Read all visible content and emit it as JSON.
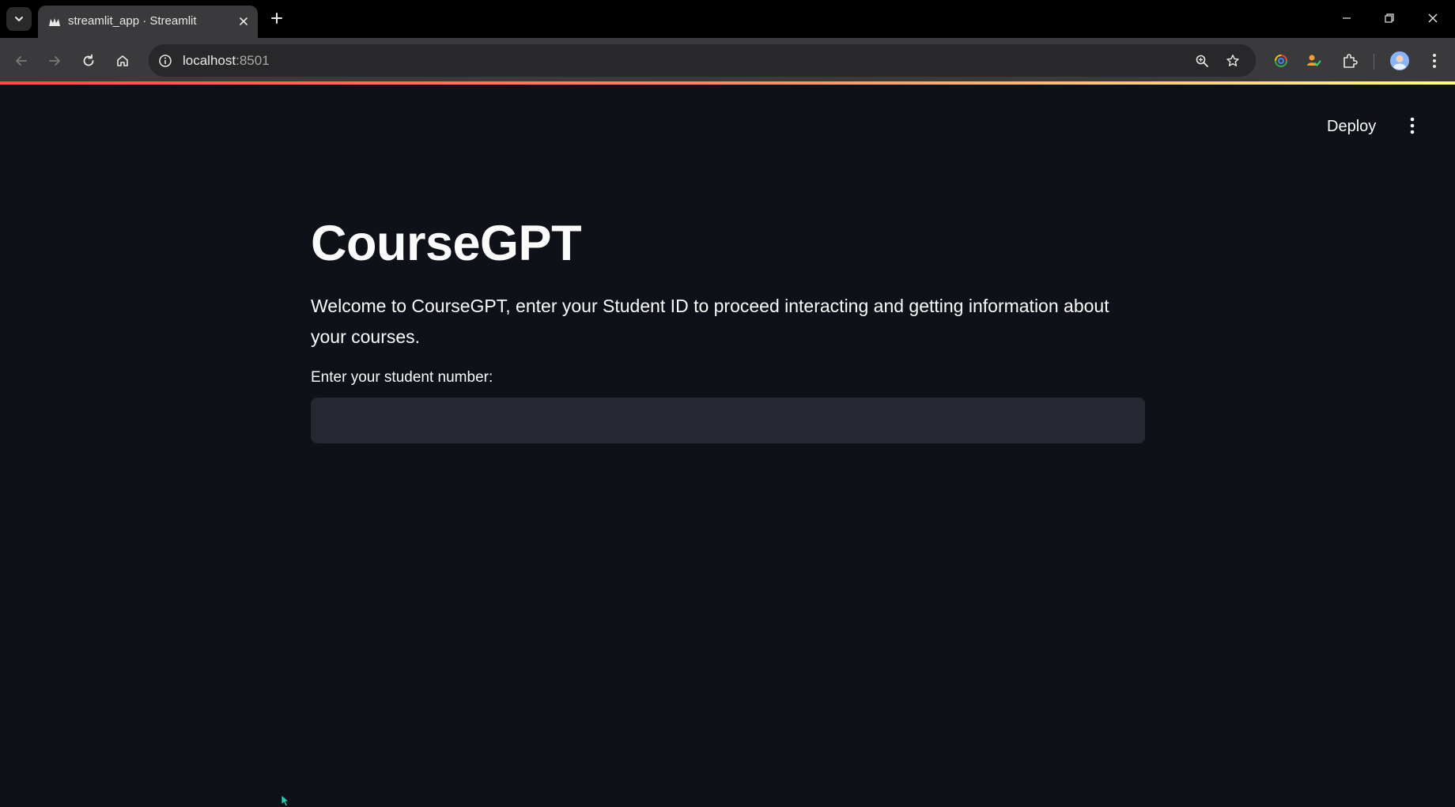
{
  "browser": {
    "tab_title": "streamlit_app · Streamlit",
    "url_host": "localhost",
    "url_port": ":8501",
    "icons": {
      "tab_list": "chevron-down-icon",
      "favicon": "streamlit-crown-icon",
      "close_tab": "close-icon",
      "new_tab": "plus-icon",
      "back": "arrow-left-icon",
      "forward": "arrow-right-icon",
      "reload": "reload-icon",
      "home": "home-icon",
      "site_info": "info-icon",
      "zoom": "zoom-icon",
      "bookmark": "star-icon",
      "extension_1": "colorful-extension-icon",
      "extension_2": "person-check-icon",
      "extensions": "puzzle-icon",
      "profile": "avatar",
      "menu": "kebab-menu-icon",
      "minimize": "minimize-icon",
      "restore": "restore-icon",
      "close_window": "close-icon"
    },
    "colors": {
      "tabbar": "#000000",
      "toolbar": "#3a3a3c",
      "loading_gradient": [
        "#ff4b4b",
        "#fffd80"
      ]
    }
  },
  "app": {
    "deploy_label": "Deploy",
    "title": "CourseGPT",
    "intro": "Welcome to CourseGPT, enter your Student ID to proceed interacting and getting information about your courses.",
    "student_field": {
      "label": "Enter your student number:",
      "value": "",
      "placeholder": ""
    },
    "colors": {
      "background": "#0e1117",
      "text": "#fafafa",
      "input_bg": "#262730"
    }
  }
}
